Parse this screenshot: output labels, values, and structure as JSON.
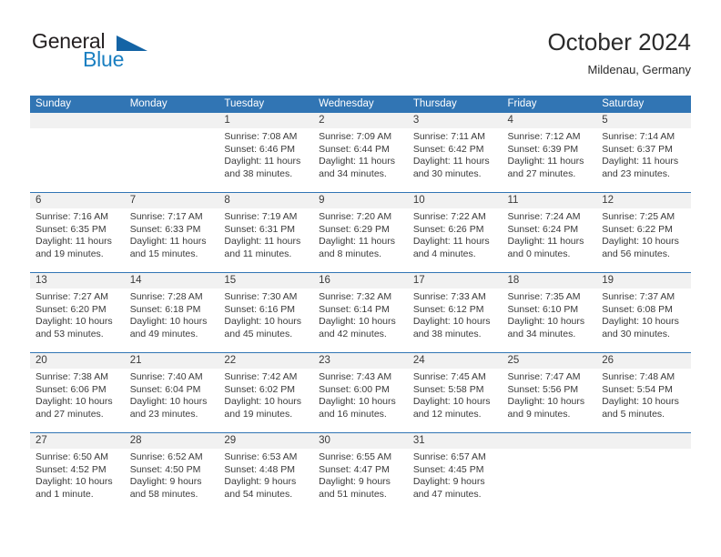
{
  "brand": {
    "name_part1": "General",
    "name_part2": "Blue",
    "accent_color": "#1a7fc1",
    "triangle_color": "#1464a5",
    "icon": "triangle-logo-icon"
  },
  "header": {
    "title": "October 2024",
    "subtitle": "Mildenau, Germany",
    "header_bar_color": "#3175b4",
    "daynum_band_color": "#f1f1f1"
  },
  "weekday_headers": [
    "Sunday",
    "Monday",
    "Tuesday",
    "Wednesday",
    "Thursday",
    "Friday",
    "Saturday"
  ],
  "weeks": [
    [
      {
        "day": "",
        "sunrise": "",
        "sunset": "",
        "daylight_l1": "",
        "daylight_l2": ""
      },
      {
        "day": "",
        "sunrise": "",
        "sunset": "",
        "daylight_l1": "",
        "daylight_l2": ""
      },
      {
        "day": "1",
        "sunrise": "Sunrise: 7:08 AM",
        "sunset": "Sunset: 6:46 PM",
        "daylight_l1": "Daylight: 11 hours",
        "daylight_l2": "and 38 minutes."
      },
      {
        "day": "2",
        "sunrise": "Sunrise: 7:09 AM",
        "sunset": "Sunset: 6:44 PM",
        "daylight_l1": "Daylight: 11 hours",
        "daylight_l2": "and 34 minutes."
      },
      {
        "day": "3",
        "sunrise": "Sunrise: 7:11 AM",
        "sunset": "Sunset: 6:42 PM",
        "daylight_l1": "Daylight: 11 hours",
        "daylight_l2": "and 30 minutes."
      },
      {
        "day": "4",
        "sunrise": "Sunrise: 7:12 AM",
        "sunset": "Sunset: 6:39 PM",
        "daylight_l1": "Daylight: 11 hours",
        "daylight_l2": "and 27 minutes."
      },
      {
        "day": "5",
        "sunrise": "Sunrise: 7:14 AM",
        "sunset": "Sunset: 6:37 PM",
        "daylight_l1": "Daylight: 11 hours",
        "daylight_l2": "and 23 minutes."
      }
    ],
    [
      {
        "day": "6",
        "sunrise": "Sunrise: 7:16 AM",
        "sunset": "Sunset: 6:35 PM",
        "daylight_l1": "Daylight: 11 hours",
        "daylight_l2": "and 19 minutes."
      },
      {
        "day": "7",
        "sunrise": "Sunrise: 7:17 AM",
        "sunset": "Sunset: 6:33 PM",
        "daylight_l1": "Daylight: 11 hours",
        "daylight_l2": "and 15 minutes."
      },
      {
        "day": "8",
        "sunrise": "Sunrise: 7:19 AM",
        "sunset": "Sunset: 6:31 PM",
        "daylight_l1": "Daylight: 11 hours",
        "daylight_l2": "and 11 minutes."
      },
      {
        "day": "9",
        "sunrise": "Sunrise: 7:20 AM",
        "sunset": "Sunset: 6:29 PM",
        "daylight_l1": "Daylight: 11 hours",
        "daylight_l2": "and 8 minutes."
      },
      {
        "day": "10",
        "sunrise": "Sunrise: 7:22 AM",
        "sunset": "Sunset: 6:26 PM",
        "daylight_l1": "Daylight: 11 hours",
        "daylight_l2": "and 4 minutes."
      },
      {
        "day": "11",
        "sunrise": "Sunrise: 7:24 AM",
        "sunset": "Sunset: 6:24 PM",
        "daylight_l1": "Daylight: 11 hours",
        "daylight_l2": "and 0 minutes."
      },
      {
        "day": "12",
        "sunrise": "Sunrise: 7:25 AM",
        "sunset": "Sunset: 6:22 PM",
        "daylight_l1": "Daylight: 10 hours",
        "daylight_l2": "and 56 minutes."
      }
    ],
    [
      {
        "day": "13",
        "sunrise": "Sunrise: 7:27 AM",
        "sunset": "Sunset: 6:20 PM",
        "daylight_l1": "Daylight: 10 hours",
        "daylight_l2": "and 53 minutes."
      },
      {
        "day": "14",
        "sunrise": "Sunrise: 7:28 AM",
        "sunset": "Sunset: 6:18 PM",
        "daylight_l1": "Daylight: 10 hours",
        "daylight_l2": "and 49 minutes."
      },
      {
        "day": "15",
        "sunrise": "Sunrise: 7:30 AM",
        "sunset": "Sunset: 6:16 PM",
        "daylight_l1": "Daylight: 10 hours",
        "daylight_l2": "and 45 minutes."
      },
      {
        "day": "16",
        "sunrise": "Sunrise: 7:32 AM",
        "sunset": "Sunset: 6:14 PM",
        "daylight_l1": "Daylight: 10 hours",
        "daylight_l2": "and 42 minutes."
      },
      {
        "day": "17",
        "sunrise": "Sunrise: 7:33 AM",
        "sunset": "Sunset: 6:12 PM",
        "daylight_l1": "Daylight: 10 hours",
        "daylight_l2": "and 38 minutes."
      },
      {
        "day": "18",
        "sunrise": "Sunrise: 7:35 AM",
        "sunset": "Sunset: 6:10 PM",
        "daylight_l1": "Daylight: 10 hours",
        "daylight_l2": "and 34 minutes."
      },
      {
        "day": "19",
        "sunrise": "Sunrise: 7:37 AM",
        "sunset": "Sunset: 6:08 PM",
        "daylight_l1": "Daylight: 10 hours",
        "daylight_l2": "and 30 minutes."
      }
    ],
    [
      {
        "day": "20",
        "sunrise": "Sunrise: 7:38 AM",
        "sunset": "Sunset: 6:06 PM",
        "daylight_l1": "Daylight: 10 hours",
        "daylight_l2": "and 27 minutes."
      },
      {
        "day": "21",
        "sunrise": "Sunrise: 7:40 AM",
        "sunset": "Sunset: 6:04 PM",
        "daylight_l1": "Daylight: 10 hours",
        "daylight_l2": "and 23 minutes."
      },
      {
        "day": "22",
        "sunrise": "Sunrise: 7:42 AM",
        "sunset": "Sunset: 6:02 PM",
        "daylight_l1": "Daylight: 10 hours",
        "daylight_l2": "and 19 minutes."
      },
      {
        "day": "23",
        "sunrise": "Sunrise: 7:43 AM",
        "sunset": "Sunset: 6:00 PM",
        "daylight_l1": "Daylight: 10 hours",
        "daylight_l2": "and 16 minutes."
      },
      {
        "day": "24",
        "sunrise": "Sunrise: 7:45 AM",
        "sunset": "Sunset: 5:58 PM",
        "daylight_l1": "Daylight: 10 hours",
        "daylight_l2": "and 12 minutes."
      },
      {
        "day": "25",
        "sunrise": "Sunrise: 7:47 AM",
        "sunset": "Sunset: 5:56 PM",
        "daylight_l1": "Daylight: 10 hours",
        "daylight_l2": "and 9 minutes."
      },
      {
        "day": "26",
        "sunrise": "Sunrise: 7:48 AM",
        "sunset": "Sunset: 5:54 PM",
        "daylight_l1": "Daylight: 10 hours",
        "daylight_l2": "and 5 minutes."
      }
    ],
    [
      {
        "day": "27",
        "sunrise": "Sunrise: 6:50 AM",
        "sunset": "Sunset: 4:52 PM",
        "daylight_l1": "Daylight: 10 hours",
        "daylight_l2": "and 1 minute."
      },
      {
        "day": "28",
        "sunrise": "Sunrise: 6:52 AM",
        "sunset": "Sunset: 4:50 PM",
        "daylight_l1": "Daylight: 9 hours",
        "daylight_l2": "and 58 minutes."
      },
      {
        "day": "29",
        "sunrise": "Sunrise: 6:53 AM",
        "sunset": "Sunset: 4:48 PM",
        "daylight_l1": "Daylight: 9 hours",
        "daylight_l2": "and 54 minutes."
      },
      {
        "day": "30",
        "sunrise": "Sunrise: 6:55 AM",
        "sunset": "Sunset: 4:47 PM",
        "daylight_l1": "Daylight: 9 hours",
        "daylight_l2": "and 51 minutes."
      },
      {
        "day": "31",
        "sunrise": "Sunrise: 6:57 AM",
        "sunset": "Sunset: 4:45 PM",
        "daylight_l1": "Daylight: 9 hours",
        "daylight_l2": "and 47 minutes."
      },
      {
        "day": "",
        "sunrise": "",
        "sunset": "",
        "daylight_l1": "",
        "daylight_l2": ""
      },
      {
        "day": "",
        "sunrise": "",
        "sunset": "",
        "daylight_l1": "",
        "daylight_l2": ""
      }
    ]
  ]
}
